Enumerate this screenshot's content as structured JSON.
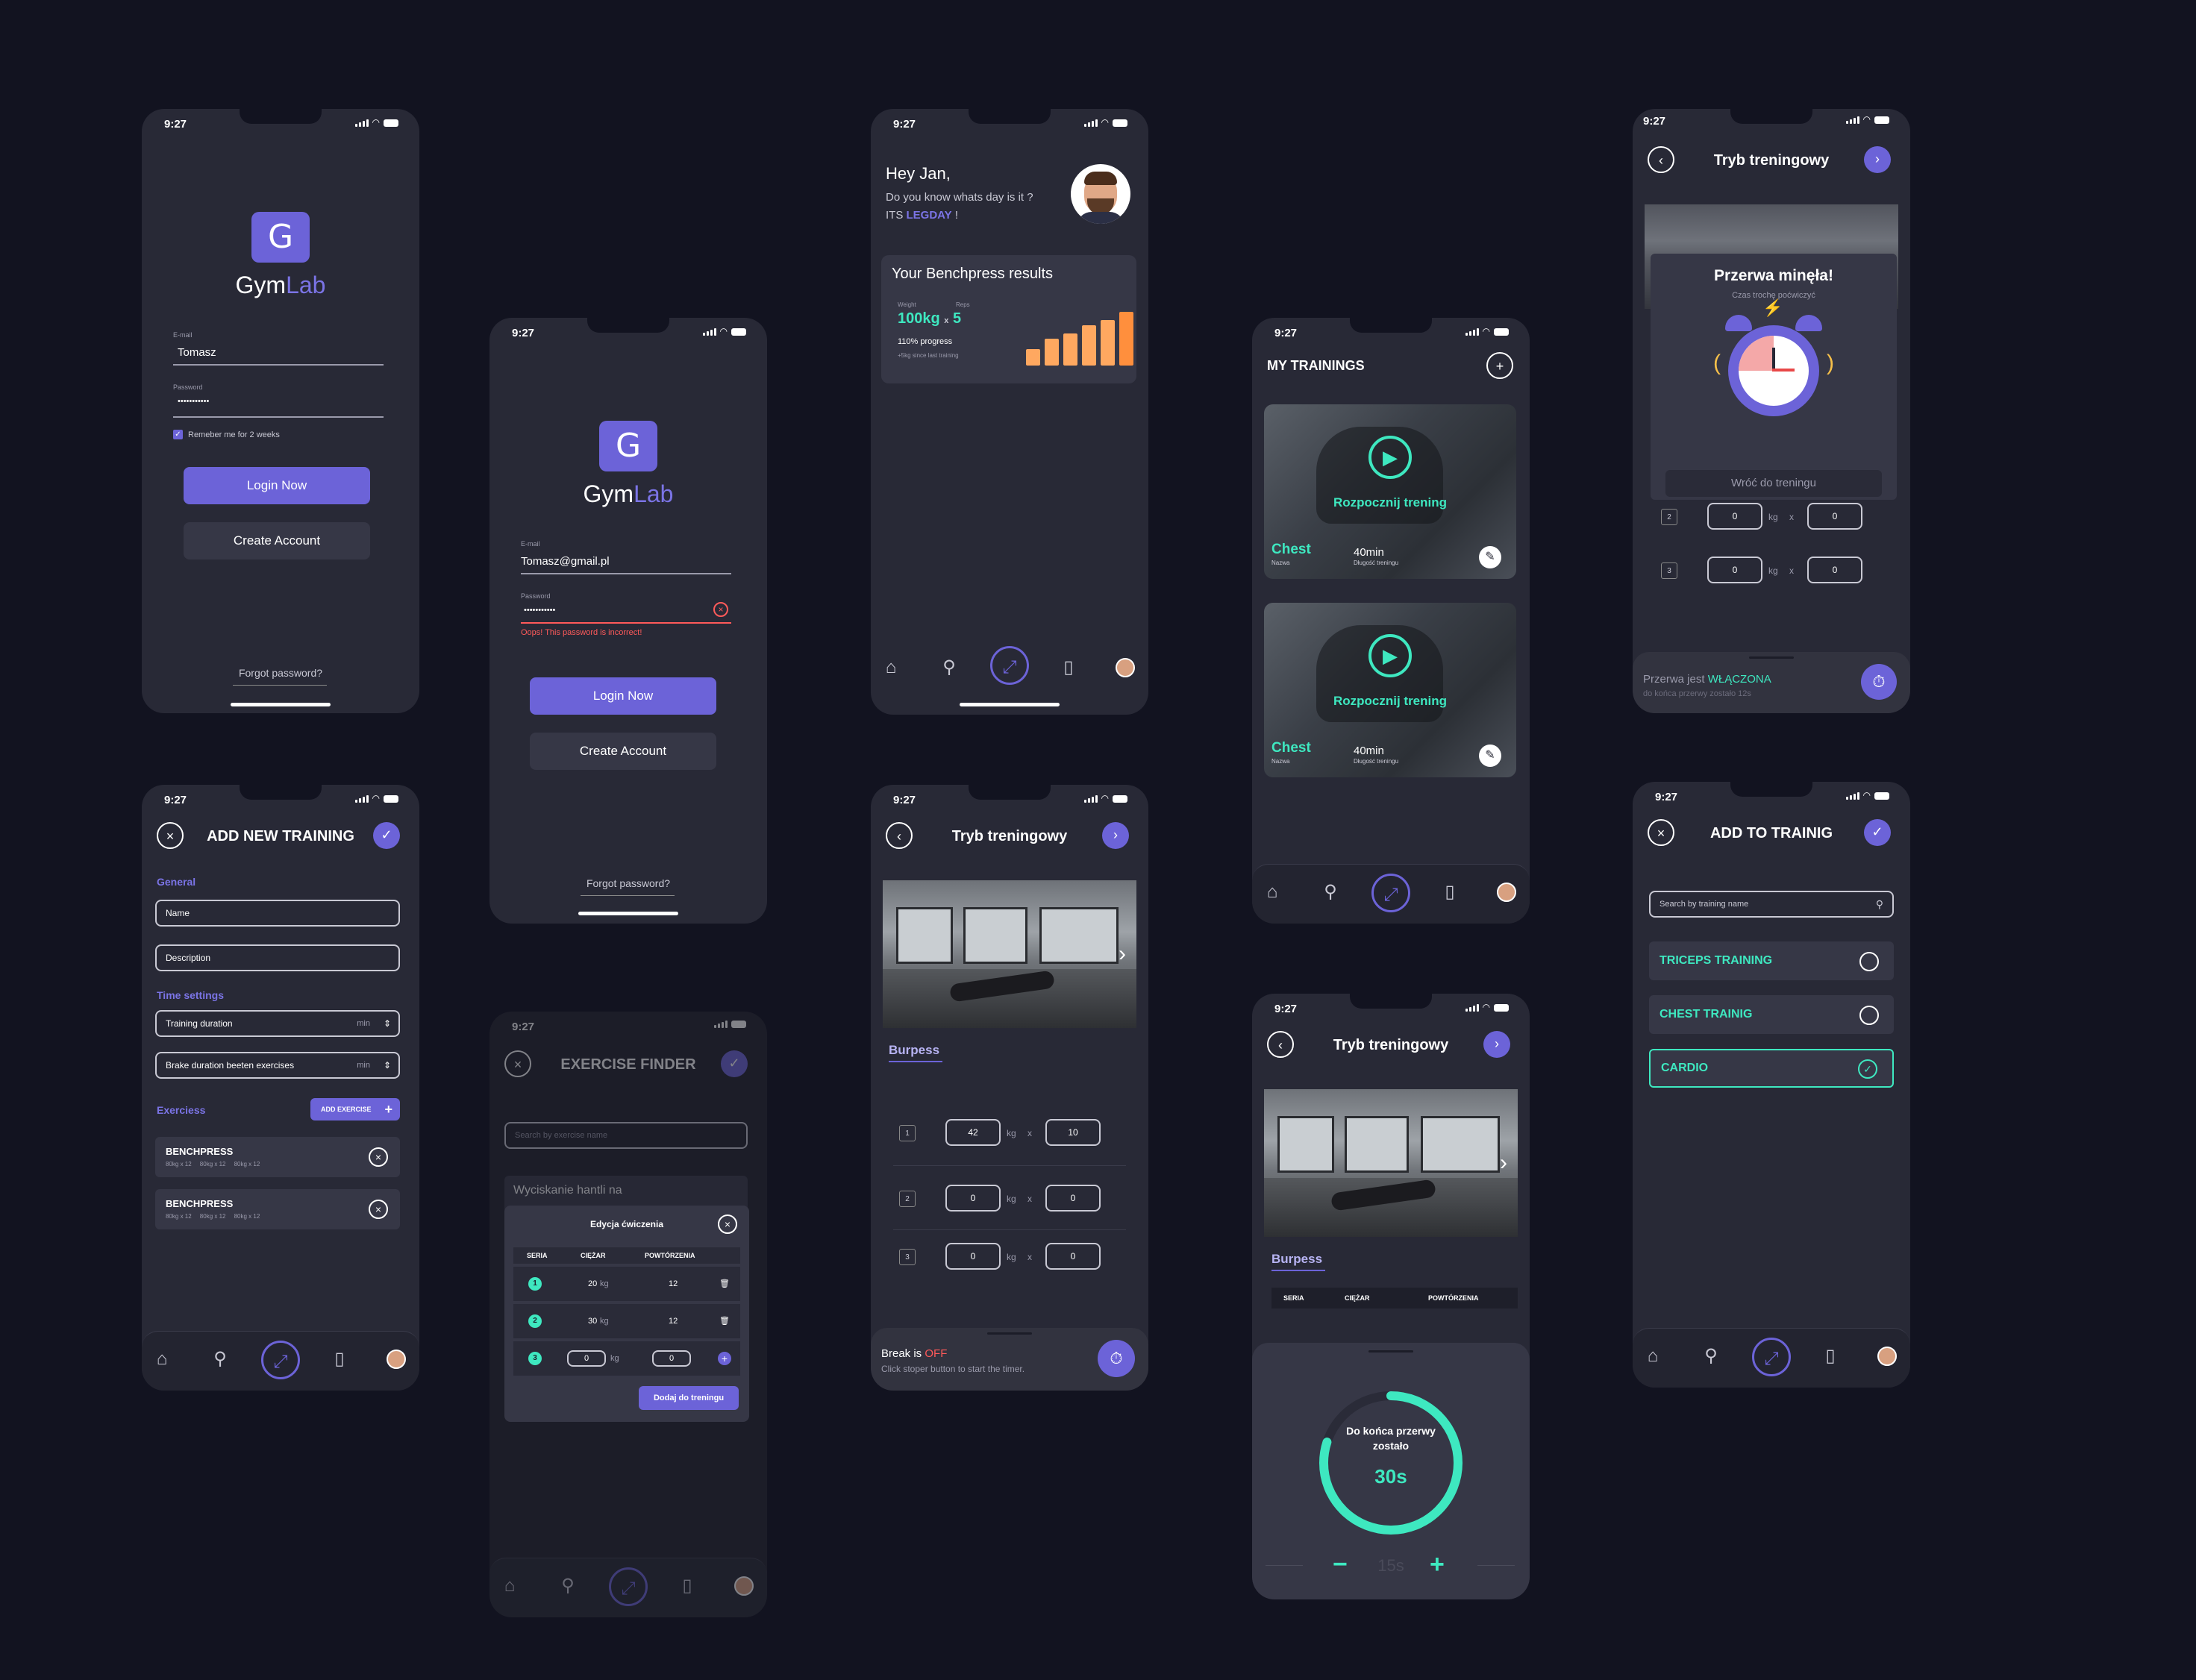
{
  "status": {
    "time": "9:27"
  },
  "brand": {
    "g": "G",
    "gym": "Gym",
    "lab": "Lab"
  },
  "login1": {
    "email_label": "E-mail",
    "email_value": "Tomasz",
    "password_label": "Password",
    "password_value": "•••••••••••",
    "remember": "Remeber me for 2 weeks",
    "login_btn": "Login Now",
    "create_btn": "Create Account",
    "forgot": "Forgot password?"
  },
  "login2": {
    "email_label": "E-mail",
    "email_value": "Tomasz@gmail.pl",
    "password_label": "Password",
    "password_value": "•••••••••••",
    "error": "Oops! This password is incorrect!",
    "login_btn": "Login Now",
    "create_btn": "Create Account",
    "forgot": "Forgot password?"
  },
  "home": {
    "greeting": "Hey Jan,",
    "question": "Do you know whats day is it ?",
    "its": "ITS",
    "legday": "LEGDAY",
    "excl": "!",
    "card_title": "Your Benchpress results",
    "weight_label": "Weight",
    "weight_value": "100kg",
    "times": "x",
    "reps_label": "Reps",
    "reps_value": "5",
    "progress": "110% progress",
    "since": "+5kg since last training",
    "bar_levels": [
      0.3,
      0.5,
      0.6,
      0.75,
      0.85,
      1.0
    ]
  },
  "add_training": {
    "title": "ADD NEW TRAINING",
    "general": "General",
    "name_ph": "Name",
    "desc_ph": "Description",
    "time_settings": "Time settings",
    "training_duration": "Training duration",
    "brake_duration": "Brake duration beeten exercises",
    "unit": "min",
    "exercises": "Exerciess",
    "add_exercise": "ADD EXERCISE",
    "rows": [
      {
        "name": "BENCHPRESS",
        "sets": "80kg x 12     80kg x 12     80kg x 12"
      },
      {
        "name": "BENCHPRESS",
        "sets": "80kg x 12     80kg x 12     80kg x 12"
      }
    ]
  },
  "finder": {
    "title": "EXERCISE FINDER",
    "search_ph": "Search by exercise name",
    "item": "Wyciskanie hantli na",
    "modal_title": "Edycja ćwiczenia",
    "cols": [
      "SERIA",
      "CIĘŻAR",
      "POWTÓRZENIA"
    ],
    "rows": [
      {
        "n": "1",
        "w": "20",
        "u": "kg",
        "r": "12"
      },
      {
        "n": "2",
        "w": "30",
        "u": "kg",
        "r": "12"
      },
      {
        "n": "3",
        "w": "0",
        "u": "kg",
        "r": "0"
      }
    ],
    "add_btn": "Dodaj do treningu"
  },
  "workout": {
    "title": "Tryb treningowy",
    "exercise": "Burpess",
    "sets": [
      {
        "n": "1",
        "w": "42",
        "r": "10"
      },
      {
        "n": "2",
        "w": "0",
        "r": "0"
      },
      {
        "n": "3",
        "w": "0",
        "r": "0"
      }
    ],
    "kg": "kg",
    "x": "x",
    "break_is": "Break is",
    "off": "OFF",
    "hint": "Click stoper button to start the timer."
  },
  "trainings": {
    "title": "MY TRAININGS",
    "cards": [
      {
        "cta": "Rozpocznij trening",
        "name": "Chest",
        "name_label": "Nazwa",
        "dur": "40min",
        "dur_label": "Długość treningu"
      },
      {
        "cta": "Rozpocznij trening",
        "name": "Chest",
        "name_label": "Nazwa",
        "dur": "40min",
        "dur_label": "Długość treningu"
      }
    ]
  },
  "timer": {
    "title": "Tryb treningowy",
    "exercise": "Burpess",
    "cols": [
      "SERIA",
      "CIĘŻAR",
      "POWTÓRZENIA"
    ],
    "label": "Do końca przerwy zostało",
    "value": "30s",
    "minus": "−",
    "step": "15s",
    "plus": "+",
    "progress": 0.8
  },
  "break_over": {
    "title": "Tryb treningowy",
    "modal_title": "Przerwa minęła!",
    "modal_sub": "Czas trochę poćwiczyć",
    "back_btn": "Wróć do treningu",
    "rows": [
      {
        "n": "2",
        "w": "0",
        "r": "0"
      },
      {
        "n": "3",
        "w": "0",
        "r": "0"
      }
    ],
    "kg": "kg",
    "x": "x",
    "break_is": "Przerwa jest",
    "on": "WŁĄCZONA",
    "remaining": "do końca przerwy zostało 12s"
  },
  "add_to_training": {
    "title": "ADD TO TRAINIG",
    "search_ph": "Search by training name",
    "items": [
      {
        "label": "TRICEPS TRAINING",
        "checked": false
      },
      {
        "label": "CHEST TRAINIG",
        "checked": false
      },
      {
        "label": "CARDIO",
        "checked": true
      }
    ]
  },
  "colors": {
    "bg": "#121320",
    "phone": "#282936",
    "accent": "#6c63d8",
    "teal": "#3ee8c0",
    "error": "#ff5a5a",
    "orange": "#ff8f3d"
  }
}
